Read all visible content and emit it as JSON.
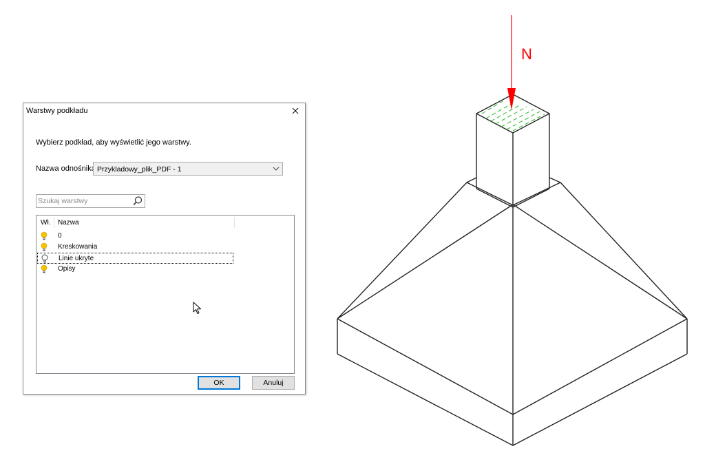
{
  "dialog": {
    "title": "Warstwy podkładu",
    "instruction": "Wybierz podkład, aby wyświetlić jego warstwy.",
    "reference_label": "Nazwa odnośnika:",
    "reference_value": "Przykladowy_plik_PDF - 1",
    "search_placeholder": "Szukaj warstwy",
    "columns": {
      "on": "Wł.",
      "name": "Nazwa"
    },
    "layers": [
      {
        "name": "0",
        "on": true
      },
      {
        "name": "Kreskowania",
        "on": true
      },
      {
        "name": "Linie ukryte",
        "on": false
      },
      {
        "name": "Opisy",
        "on": true
      }
    ],
    "ok_label": "OK",
    "cancel_label": "Anuluj"
  },
  "drawing": {
    "load_label": "N",
    "load_color": "#ff0000",
    "hatch_color": "#22bb22"
  },
  "icons": [
    "close-icon",
    "chevron-down-icon",
    "search-icon",
    "lightbulb-on-icon",
    "lightbulb-off-icon",
    "mouse-cursor-icon"
  ]
}
